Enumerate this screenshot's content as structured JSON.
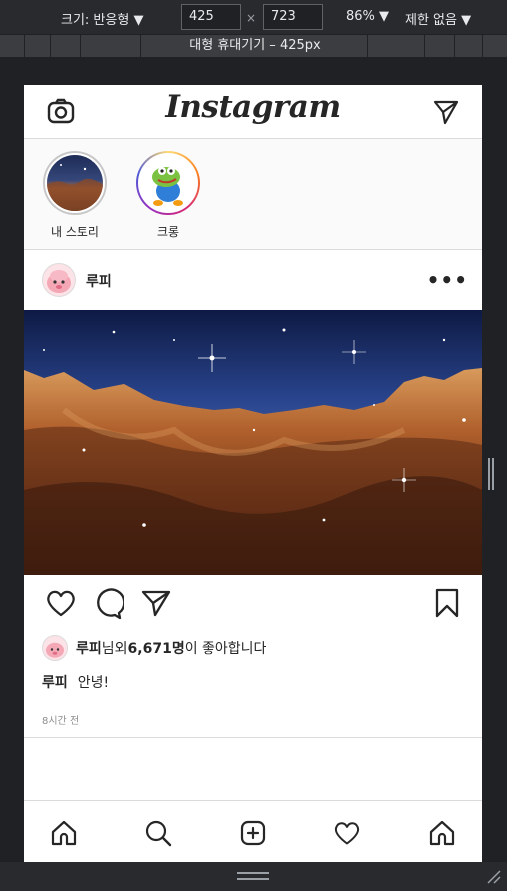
{
  "devtools": {
    "size_label": "크기: 반응형 ▼",
    "width": "425",
    "height": "723",
    "zoom": "86% ▼",
    "throttle": "제한 없음 ▼",
    "device_label": "대형 휴대기기 – 425px"
  },
  "header": {
    "logo": "Instagram"
  },
  "stories": [
    {
      "name": "내 스토리"
    },
    {
      "name": "크롱"
    }
  ],
  "post": {
    "username": "루피",
    "more": "•••",
    "liked_by": "루피",
    "liked_suffix": "님외 ",
    "likes_count": "6,671명",
    "likes_tail": "이 좋아합니다",
    "caption_user": "루피",
    "caption_text": "안녕!",
    "time": "8시간 전"
  },
  "icons": [
    "camera-icon",
    "direct-message-icon",
    "more-icon",
    "heart-icon",
    "comment-icon",
    "share-icon",
    "bookmark-icon",
    "home-icon",
    "search-icon",
    "add-icon",
    "activity-icon",
    "profile-icon"
  ]
}
